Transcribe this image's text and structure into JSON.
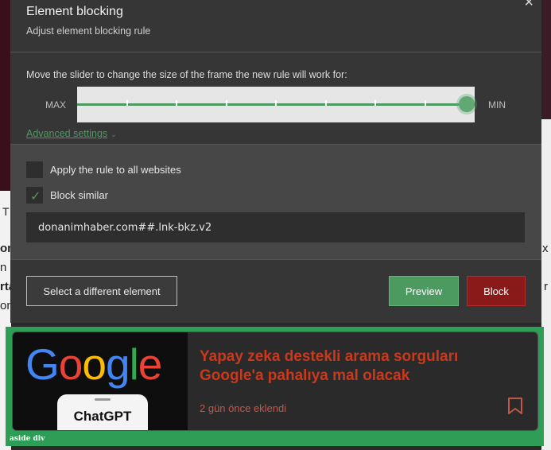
{
  "dialog": {
    "title": "Element blocking",
    "subtitle": "Adjust element blocking rule",
    "close_glyph": "×",
    "slider_instruction": "Move the slider to change the size of the frame the new rule will work for:",
    "slider_max_label": "MAX",
    "slider_min_label": "MIN",
    "slider_position": 1.0,
    "slider_steps": 8,
    "advanced_label": "Advanced settings",
    "advanced_chevron": "⌄",
    "apply_all_label": "Apply the rule to all websites",
    "apply_all_checked": false,
    "block_similar_label": "Block similar",
    "block_similar_checked": true,
    "checkmark_glyph": "✓",
    "rule_value": "donanimhaber.com##.lnk-bkz.v2",
    "select_different_label": "Select a different element",
    "preview_label": "Preview",
    "block_label": "Block"
  },
  "background_fragments": {
    "f1": "T",
    "f2": "on",
    "f3": "n",
    "f4": "rta",
    "f5": "on",
    "f6": "x",
    "f7": "r"
  },
  "highlight": {
    "tag_label": "aside div",
    "article": {
      "logo_text": "Google",
      "phone_text": "ChatGPT",
      "title": "Yapay zeka destekli arama sorguları Google'a pahalıya mal olacak",
      "meta": "2 gün önce eklendi",
      "bookmark_icon": "bookmark-icon"
    }
  },
  "colors": {
    "accent_green": "#4c9a60",
    "block_red": "#8a1a1a",
    "highlight_green": "#2e9d55",
    "title_red": "#c83a1e"
  }
}
